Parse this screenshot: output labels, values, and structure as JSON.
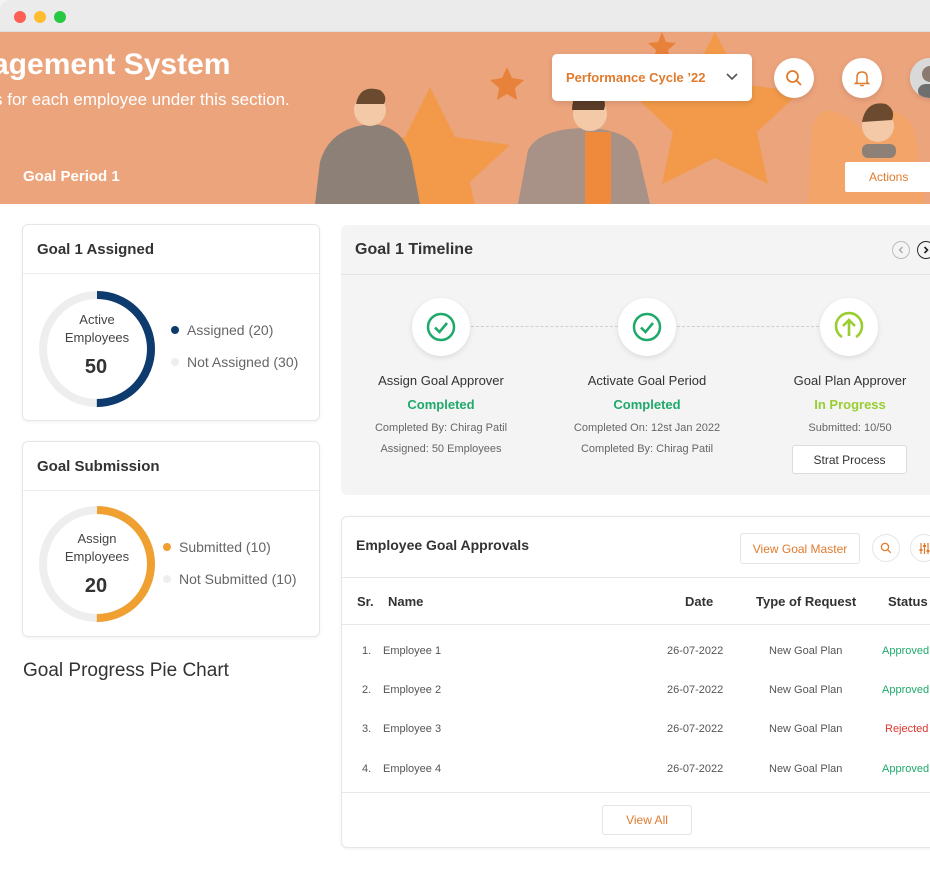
{
  "colors": {
    "accent": "#e07b2e",
    "banner": "#eca47d",
    "navy": "#0d3b6e",
    "amber": "#f0a030",
    "green": "#1fa96b",
    "lime": "#9acd32",
    "red": "#d9352b"
  },
  "banner": {
    "title": "agement System",
    "subtitle": "s for each employee under this section.",
    "goal_period": "Goal Period 1",
    "cycle_select": "Performance Cycle ’22",
    "actions_label": "Actions"
  },
  "assigned_card": {
    "title": "Goal 1 Assigned",
    "donut_label_1": "Active",
    "donut_label_2": "Employees",
    "total": "50",
    "assigned_fraction": 0.5,
    "legend_assigned": "Assigned (20)",
    "legend_not_assigned": "Not Assigned (30)"
  },
  "submission_card": {
    "title": "Goal Submission",
    "donut_label_1": "Assign",
    "donut_label_2": "Employees",
    "total": "20",
    "submitted_fraction": 0.5,
    "legend_submitted": "Submitted (10)",
    "legend_not_submitted": "Not Submitted (10)"
  },
  "pie_section_title": "Goal Progress Pie Chart",
  "timeline": {
    "title": "Goal 1 Timeline",
    "steps": [
      {
        "title": "Assign Goal Approver",
        "status": "Completed",
        "meta1": "Completed By: Chirag Patil",
        "meta2": "Assigned: 50 Employees"
      },
      {
        "title": "Activate Goal Period",
        "status": "Completed",
        "meta1": "Completed On: 12st Jan 2022",
        "meta2": "Completed By: Chirag Patil"
      },
      {
        "title": "Goal Plan Approver",
        "status": "In Progress",
        "meta1": "Submitted: 10/50",
        "button": "Strat Process"
      }
    ]
  },
  "approvals": {
    "title": "Employee Goal Approvals",
    "view_master": "View Goal Master",
    "headers": {
      "sr": "Sr.",
      "name": "Name",
      "date": "Date",
      "type": "Type of Request",
      "status": "Status"
    },
    "rows": [
      {
        "sr": "1.",
        "name": "Employee 1",
        "date": "26-07-2022",
        "type": "New Goal Plan",
        "status": "Approved"
      },
      {
        "sr": "2.",
        "name": "Employee 2",
        "date": "26-07-2022",
        "type": "New Goal Plan",
        "status": "Approved"
      },
      {
        "sr": "3.",
        "name": "Employee 3",
        "date": "26-07-2022",
        "type": "New Goal Plan",
        "status": "Rejected"
      },
      {
        "sr": "4.",
        "name": "Employee 4",
        "date": "26-07-2022",
        "type": "New Goal Plan",
        "status": "Approved"
      }
    ],
    "view_all": "View All"
  }
}
